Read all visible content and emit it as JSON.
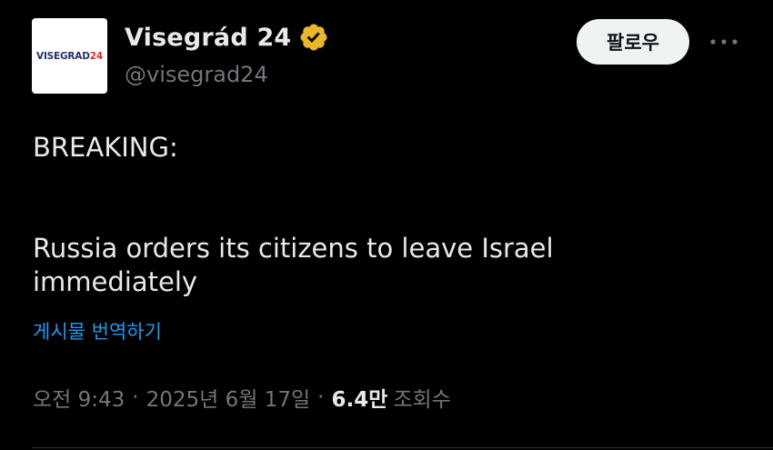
{
  "account": {
    "avatar_text_main": "VISEGRAD",
    "avatar_text_accent": "24",
    "display_name": "Visegrád 24",
    "handle": "@visegrad24",
    "verified_icon": "verified-badge-icon",
    "badge_color": "#e8b829"
  },
  "actions": {
    "follow_label": "팔로우",
    "more_icon": "more-horizontal-icon"
  },
  "tweet": {
    "line1": "BREAKING:",
    "line2": "Russia orders its citizens to leave Israel",
    "line3": "immediately",
    "translate_label": "게시물 번역하기"
  },
  "meta": {
    "time": "오전 9:43",
    "separator": "·",
    "date": "2025년 6월 17일",
    "views_count": "6.4만",
    "views_label": "조회수"
  },
  "colors": {
    "background": "#000000",
    "text_primary": "#e7e9ea",
    "text_secondary": "#71767b",
    "link": "#1d9bf0",
    "follow_button_bg": "#eff3f4"
  }
}
